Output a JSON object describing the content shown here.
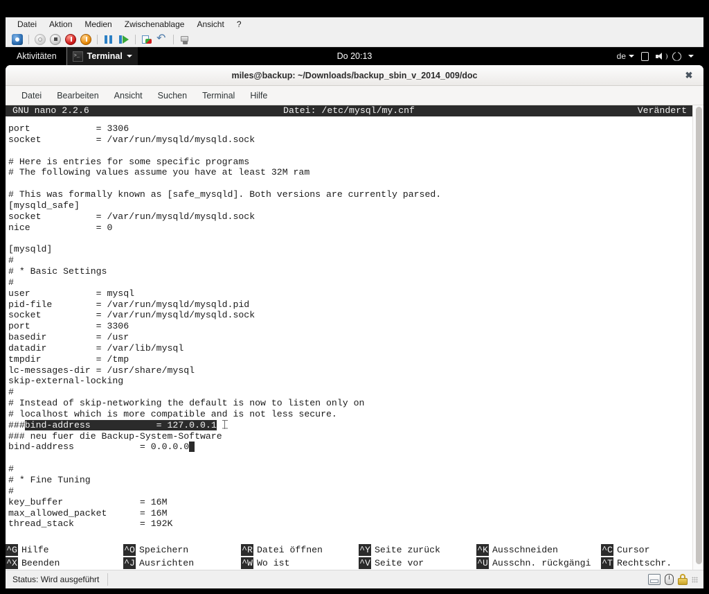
{
  "vbox": {
    "menu": [
      "Datei",
      "Aktion",
      "Medien",
      "Zwischenablage",
      "Ansicht",
      "?"
    ],
    "toolbar_icons": [
      "virtualbox-icon",
      "power-off-icon",
      "stop-icon",
      "reset-icon",
      "acpi-shutdown-icon",
      "pause-icon",
      "resume-icon",
      "snapshot-icon",
      "undo-icon",
      "network-settings-icon"
    ],
    "status": {
      "text": "Status: Wird ausgeführt",
      "icons": [
        "disk-activity-icon",
        "mouse-integration-icon",
        "host-key-lock-icon",
        "resize-grip-icon"
      ]
    }
  },
  "gnome": {
    "activities": "Aktivitäten",
    "app_name": "Terminal",
    "app_icon": "terminal-icon",
    "clock": "Do 20:13",
    "keyboard_layout": "de",
    "tray_icons": [
      "screen-icon",
      "volume-icon",
      "power-icon"
    ]
  },
  "terminal": {
    "title": "miles@backup: ~/Downloads/backup_sbin_v_2014_009/doc",
    "close_label": "✖",
    "menu": [
      "Datei",
      "Bearbeiten",
      "Ansicht",
      "Suchen",
      "Terminal",
      "Hilfe"
    ]
  },
  "nano": {
    "version": "GNU nano 2.2.6",
    "file_label": "Datei: /etc/mysql/my.cnf",
    "modified_label": "Verändert",
    "lines": [
      "port            = 3306",
      "socket          = /var/run/mysqld/mysqld.sock",
      "",
      "# Here is entries for some specific programs",
      "# The following values assume you have at least 32M ram",
      "",
      "# This was formally known as [safe_mysqld]. Both versions are currently parsed.",
      "[mysqld_safe]",
      "socket          = /var/run/mysqld/mysqld.sock",
      "nice            = 0",
      "",
      "[mysqld]",
      "#",
      "# * Basic Settings",
      "#",
      "user            = mysql",
      "pid-file        = /var/run/mysqld/mysqld.pid",
      "socket          = /var/run/mysqld/mysqld.sock",
      "port            = 3306",
      "basedir         = /usr",
      "datadir         = /var/lib/mysql",
      "tmpdir          = /tmp",
      "lc-messages-dir = /usr/share/mysql",
      "skip-external-locking",
      "#",
      "# Instead of skip-networking the default is now to listen only on",
      "# localhost which is more compatible and is not less secure."
    ],
    "selected_line": {
      "prefix": "###",
      "selection": "bind-address            = 127.0.0.1"
    },
    "lines_after": [
      "### neu fuer die Backup-System-Software"
    ],
    "cursor_line": {
      "text": "bind-address            = 0.0.0.0",
      "cursor_char": " "
    },
    "lines_tail": [
      "",
      "#",
      "# * Fine Tuning",
      "#",
      "key_buffer              = 16M",
      "max_allowed_packet      = 16M",
      "thread_stack            = 192K"
    ],
    "shortcuts": [
      {
        "key": "^G",
        "label": "Hilfe",
        "key2": "^X",
        "label2": "Beenden"
      },
      {
        "key": "^O",
        "label": "Speichern",
        "key2": "^J",
        "label2": "Ausrichten"
      },
      {
        "key": "^R",
        "label": "Datei öffnen",
        "key2": "^W",
        "label2": "Wo ist"
      },
      {
        "key": "^Y",
        "label": "Seite zurück",
        "key2": "^V",
        "label2": "Seite vor"
      },
      {
        "key": "^K",
        "label": "Ausschneiden",
        "key2": "^U",
        "label2": "Ausschn. rückgängi"
      },
      {
        "key": "^C",
        "label": "Cursor",
        "key2": "^T",
        "label2": "Rechtschr."
      }
    ]
  },
  "colors": {
    "terminal_bg": "#ffffff",
    "terminal_fg": "#1a1a1a",
    "inverse_bg": "#2b2b2b",
    "inverse_fg": "#f2f2f2",
    "gnome_bar": "#000000",
    "vbox_chrome": "#f0f0f0"
  }
}
